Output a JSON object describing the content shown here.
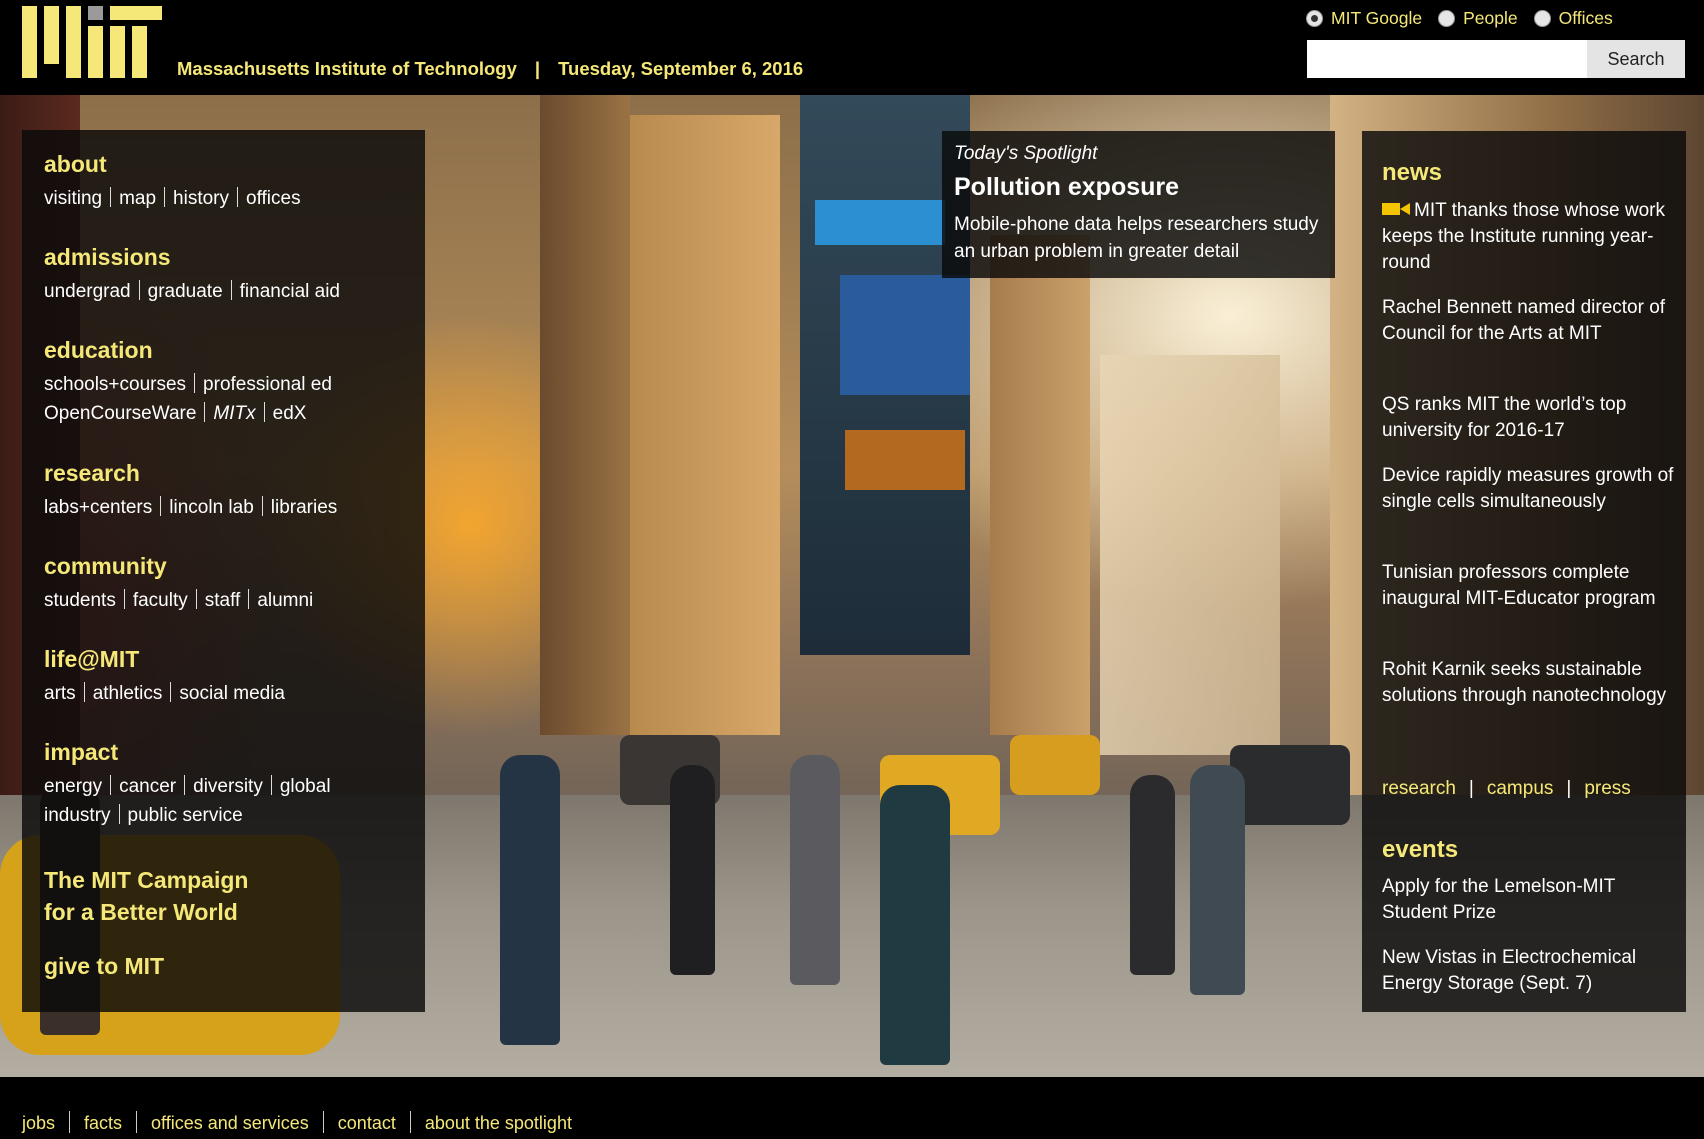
{
  "header": {
    "site_name": "Massachusetts Institute of Technology",
    "separator": "|",
    "date": "Tuesday, September 6, 2016"
  },
  "search": {
    "scopes": [
      {
        "label": "MIT Google",
        "checked": true
      },
      {
        "label": "People",
        "checked": false
      },
      {
        "label": "Offices",
        "checked": false
      }
    ],
    "placeholder": "",
    "value": "",
    "button_label": "Search"
  },
  "nav": {
    "about": {
      "heading": "about",
      "links": [
        "visiting",
        "map",
        "history",
        "offices"
      ]
    },
    "admissions": {
      "heading": "admissions",
      "links": [
        "undergrad",
        "graduate",
        "financial aid"
      ]
    },
    "education": {
      "heading": "education",
      "links_row1": [
        "schools+courses",
        "professional ed"
      ],
      "links_row2": [
        "OpenCourseWare",
        "MITx",
        "edX"
      ]
    },
    "research": {
      "heading": "research",
      "links": [
        "labs+centers",
        "lincoln lab",
        "libraries"
      ]
    },
    "community": {
      "heading": "community",
      "links": [
        "students",
        "faculty",
        "staff",
        "alumni"
      ]
    },
    "life": {
      "heading": "life@MIT",
      "links": [
        "arts",
        "athletics",
        "social media"
      ]
    },
    "impact": {
      "heading": "impact",
      "links_row1": [
        "energy",
        "cancer",
        "diversity",
        "global"
      ],
      "links_row2": [
        "industry",
        "public service"
      ]
    },
    "campaign": {
      "line1": "The MIT Campaign",
      "line2": "for a Better World"
    },
    "give": "give to MIT"
  },
  "spotlight": {
    "label": "Today's Spotlight",
    "title": "Pollution exposure",
    "description": "Mobile-phone data helps researchers study an urban problem in greater detail"
  },
  "news": {
    "heading": "news",
    "items": [
      "MIT thanks those whose work keeps the Institute running year-round",
      "Rachel Bennett named director of Council for the Arts at MIT",
      "QS ranks MIT the world’s top university for 2016-17",
      "Device rapidly measures growth of single cells simultaneously",
      "Tunisian professors complete inaugural MIT-Educator program",
      "Rohit Karnik seeks sustainable solutions through nanotechnology"
    ],
    "links": [
      "research",
      "campus",
      "press"
    ],
    "link_separator": "|"
  },
  "events": {
    "heading": "events",
    "items": [
      "Apply for the Lemelson-MIT Student Prize",
      "New Vistas in Electrochemical Energy Storage (Sept. 7)"
    ]
  },
  "footer": {
    "links": [
      "jobs",
      "facts",
      "offices and services",
      "contact",
      "about the spotlight"
    ]
  },
  "colors": {
    "accent_yellow": "#f5e878",
    "panel_bg": "#0a0a0a",
    "logo_grey": "#9a9a9a"
  },
  "icons": {
    "logo": "mit-logo",
    "video": "video-camera-icon"
  }
}
